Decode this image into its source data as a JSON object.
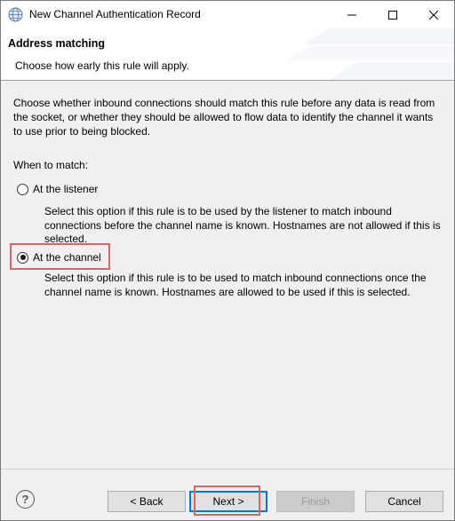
{
  "window": {
    "title": "New Channel Authentication Record"
  },
  "banner": {
    "title": "Address matching",
    "description": "Choose how early this rule will apply."
  },
  "content": {
    "intro": "Choose whether inbound connections should match this rule before any data is read from the socket, or whether they should be allowed to flow data to identify the channel it wants to use prior to being blocked.",
    "when_label": "When to match:",
    "options": [
      {
        "label": "At the listener",
        "checked": false,
        "description": "Select this option if this rule is to be used by the listener to match inbound connections before the channel name is known. Hostnames are not allowed if this is selected."
      },
      {
        "label": "At the channel",
        "checked": true,
        "description": "Select this option if this rule is to be used to match inbound connections once the channel name is known. Hostnames are allowed to be used if this is selected."
      }
    ]
  },
  "footer": {
    "help": "?",
    "back": "< Back",
    "next": "Next >",
    "finish": "Finish",
    "cancel": "Cancel"
  },
  "colors": {
    "highlight": "#e06363",
    "default_button_border": "#0078d7"
  }
}
